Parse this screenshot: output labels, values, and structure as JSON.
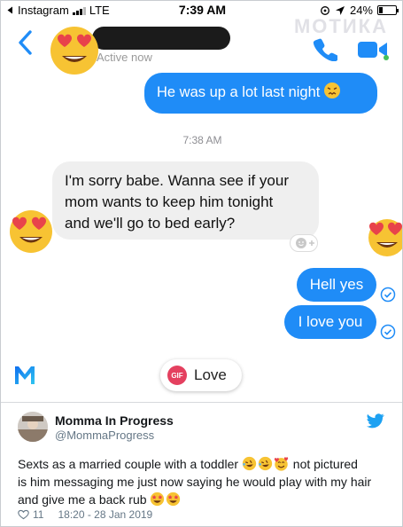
{
  "status_bar": {
    "app": "Instagram",
    "network": "LTE",
    "time": "7:39 AM",
    "battery": "24%",
    "battery_level": 0.24
  },
  "watermark": "МОТИКА",
  "chat_header": {
    "status": "Active now",
    "icons": [
      "back-chevron-icon",
      "phone-icon",
      "video-camera-icon"
    ]
  },
  "messages": [
    {
      "direction": "out",
      "text": "He was up a lot last night"
    },
    {
      "type": "timestamp",
      "text": "7:38 AM"
    },
    {
      "direction": "in",
      "lines": [
        "I'm sorry babe. Wanna see if your",
        "mom wants to keep him tonight",
        "and we'll go to bed early?"
      ]
    },
    {
      "direction": "out",
      "text": "Hell yes"
    },
    {
      "direction": "out",
      "text": "I love you"
    }
  ],
  "composer": {
    "gif_badge": "GIF",
    "gif_label": "Love"
  },
  "tweet": {
    "name": "Momma In Progress",
    "handle": "@MommaProgress",
    "lines": [
      "Sexts as a married couple with a toddler",
      "not pictured",
      "is him messaging me just now saying he would play with my hair",
      "and give me a back rub"
    ],
    "likes": "11",
    "timestamp": "18:20 - 28 Jan 2019"
  },
  "colors": {
    "outgoing_bubble": "#1f8cf7",
    "incoming_bubble": "#efefef",
    "twitter_blue": "#1da1f2",
    "gif_badge": "#e4405f"
  }
}
